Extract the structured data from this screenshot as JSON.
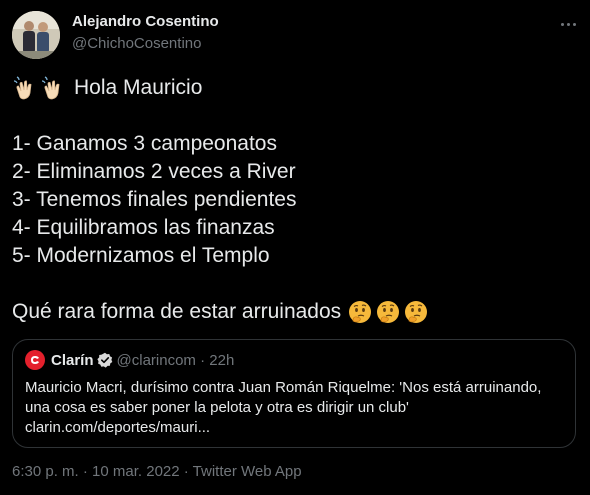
{
  "author": {
    "name": "Alejandro Cosentino",
    "handle": "@ChichoCosentino"
  },
  "tweet": {
    "greeting": "Hola Mauricio",
    "greeting_emoji": "clapping-hands-emoji",
    "list": [
      "1- Ganamos 3 campeonatos",
      "2- Eliminamos 2 veces a River",
      "3- Tenemos finales pendientes",
      "4- Equilibramos las finanzas",
      "5- Modernizamos el Templo"
    ],
    "closing": "Qué rara forma de estar arruinados",
    "closing_emoji": "thinking-face-emoji"
  },
  "quote": {
    "name": "Clarín",
    "meta": "@clarincom · 22h",
    "lines": [
      "Mauricio Macri, durísimo contra Juan Román Riquelme: 'Nos está arruinando,",
      "una cosa es saber poner la pelota y otra es dirigir un club'",
      "clarin.com/deportes/mauri..."
    ],
    "logo_color": "#e4202c",
    "verified_color": "#d9d9d9"
  },
  "footer": {
    "timestamp": "6:30 p. m. · 10 mar. 2022 · Twitter Web App"
  },
  "colors": {
    "background": "#000000",
    "text": "#e7e9ea",
    "muted": "#71767b",
    "border": "#2f3336"
  }
}
